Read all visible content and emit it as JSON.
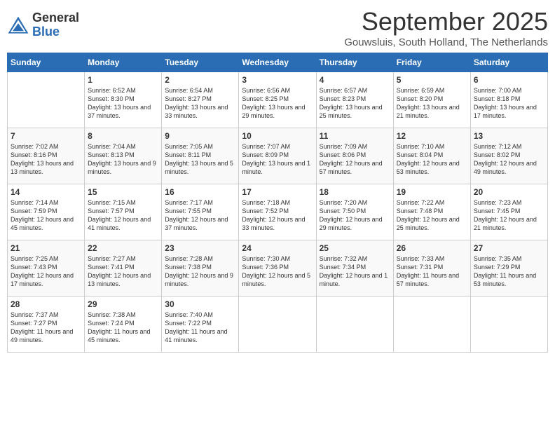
{
  "header": {
    "logo_general": "General",
    "logo_blue": "Blue",
    "month_year": "September 2025",
    "location": "Gouwsluis, South Holland, The Netherlands"
  },
  "days_of_week": [
    "Sunday",
    "Monday",
    "Tuesday",
    "Wednesday",
    "Thursday",
    "Friday",
    "Saturday"
  ],
  "weeks": [
    [
      {
        "day": "",
        "content": ""
      },
      {
        "day": "1",
        "content": "Sunrise: 6:52 AM\nSunset: 8:30 PM\nDaylight: 13 hours and 37 minutes."
      },
      {
        "day": "2",
        "content": "Sunrise: 6:54 AM\nSunset: 8:27 PM\nDaylight: 13 hours and 33 minutes."
      },
      {
        "day": "3",
        "content": "Sunrise: 6:56 AM\nSunset: 8:25 PM\nDaylight: 13 hours and 29 minutes."
      },
      {
        "day": "4",
        "content": "Sunrise: 6:57 AM\nSunset: 8:23 PM\nDaylight: 13 hours and 25 minutes."
      },
      {
        "day": "5",
        "content": "Sunrise: 6:59 AM\nSunset: 8:20 PM\nDaylight: 13 hours and 21 minutes."
      },
      {
        "day": "6",
        "content": "Sunrise: 7:00 AM\nSunset: 8:18 PM\nDaylight: 13 hours and 17 minutes."
      }
    ],
    [
      {
        "day": "7",
        "content": "Sunrise: 7:02 AM\nSunset: 8:16 PM\nDaylight: 13 hours and 13 minutes."
      },
      {
        "day": "8",
        "content": "Sunrise: 7:04 AM\nSunset: 8:13 PM\nDaylight: 13 hours and 9 minutes."
      },
      {
        "day": "9",
        "content": "Sunrise: 7:05 AM\nSunset: 8:11 PM\nDaylight: 13 hours and 5 minutes."
      },
      {
        "day": "10",
        "content": "Sunrise: 7:07 AM\nSunset: 8:09 PM\nDaylight: 13 hours and 1 minute."
      },
      {
        "day": "11",
        "content": "Sunrise: 7:09 AM\nSunset: 8:06 PM\nDaylight: 12 hours and 57 minutes."
      },
      {
        "day": "12",
        "content": "Sunrise: 7:10 AM\nSunset: 8:04 PM\nDaylight: 12 hours and 53 minutes."
      },
      {
        "day": "13",
        "content": "Sunrise: 7:12 AM\nSunset: 8:02 PM\nDaylight: 12 hours and 49 minutes."
      }
    ],
    [
      {
        "day": "14",
        "content": "Sunrise: 7:14 AM\nSunset: 7:59 PM\nDaylight: 12 hours and 45 minutes."
      },
      {
        "day": "15",
        "content": "Sunrise: 7:15 AM\nSunset: 7:57 PM\nDaylight: 12 hours and 41 minutes."
      },
      {
        "day": "16",
        "content": "Sunrise: 7:17 AM\nSunset: 7:55 PM\nDaylight: 12 hours and 37 minutes."
      },
      {
        "day": "17",
        "content": "Sunrise: 7:18 AM\nSunset: 7:52 PM\nDaylight: 12 hours and 33 minutes."
      },
      {
        "day": "18",
        "content": "Sunrise: 7:20 AM\nSunset: 7:50 PM\nDaylight: 12 hours and 29 minutes."
      },
      {
        "day": "19",
        "content": "Sunrise: 7:22 AM\nSunset: 7:48 PM\nDaylight: 12 hours and 25 minutes."
      },
      {
        "day": "20",
        "content": "Sunrise: 7:23 AM\nSunset: 7:45 PM\nDaylight: 12 hours and 21 minutes."
      }
    ],
    [
      {
        "day": "21",
        "content": "Sunrise: 7:25 AM\nSunset: 7:43 PM\nDaylight: 12 hours and 17 minutes."
      },
      {
        "day": "22",
        "content": "Sunrise: 7:27 AM\nSunset: 7:41 PM\nDaylight: 12 hours and 13 minutes."
      },
      {
        "day": "23",
        "content": "Sunrise: 7:28 AM\nSunset: 7:38 PM\nDaylight: 12 hours and 9 minutes."
      },
      {
        "day": "24",
        "content": "Sunrise: 7:30 AM\nSunset: 7:36 PM\nDaylight: 12 hours and 5 minutes."
      },
      {
        "day": "25",
        "content": "Sunrise: 7:32 AM\nSunset: 7:34 PM\nDaylight: 12 hours and 1 minute."
      },
      {
        "day": "26",
        "content": "Sunrise: 7:33 AM\nSunset: 7:31 PM\nDaylight: 11 hours and 57 minutes."
      },
      {
        "day": "27",
        "content": "Sunrise: 7:35 AM\nSunset: 7:29 PM\nDaylight: 11 hours and 53 minutes."
      }
    ],
    [
      {
        "day": "28",
        "content": "Sunrise: 7:37 AM\nSunset: 7:27 PM\nDaylight: 11 hours and 49 minutes."
      },
      {
        "day": "29",
        "content": "Sunrise: 7:38 AM\nSunset: 7:24 PM\nDaylight: 11 hours and 45 minutes."
      },
      {
        "day": "30",
        "content": "Sunrise: 7:40 AM\nSunset: 7:22 PM\nDaylight: 11 hours and 41 minutes."
      },
      {
        "day": "",
        "content": ""
      },
      {
        "day": "",
        "content": ""
      },
      {
        "day": "",
        "content": ""
      },
      {
        "day": "",
        "content": ""
      }
    ]
  ]
}
